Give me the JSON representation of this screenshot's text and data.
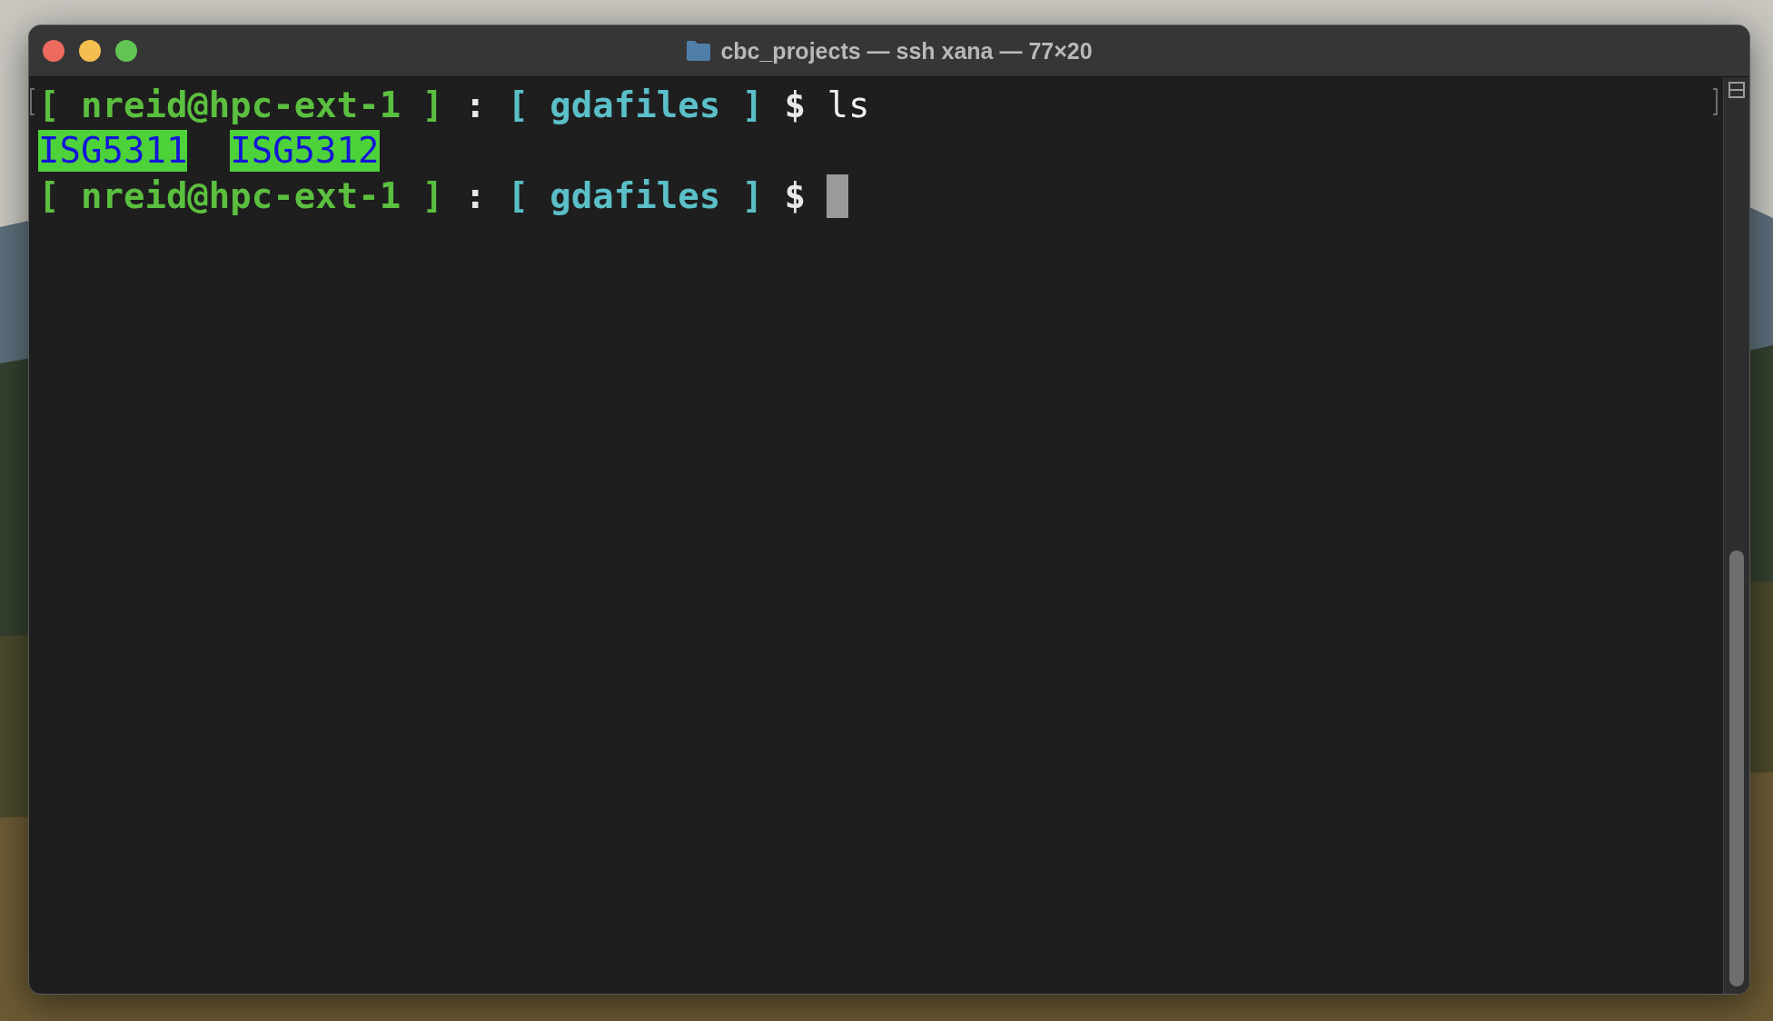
{
  "window": {
    "title": "cbc_projects — ssh xana — 77×20"
  },
  "terminal": {
    "lines": [
      {
        "cursor": false,
        "segments": [
          {
            "kind": "user",
            "text": "[ nreid@hpc-ext-1 ]"
          },
          {
            "kind": "sep",
            "text": ":"
          },
          {
            "kind": "path",
            "text": "[ gdafiles ]"
          },
          {
            "kind": "dollar",
            "text": "$"
          },
          {
            "kind": "command",
            "text": "ls"
          }
        ]
      },
      {
        "cursor": false,
        "segments": [
          {
            "kind": "dir",
            "text": "ISG5311"
          },
          {
            "kind": "dir",
            "text": "ISG5312"
          }
        ]
      },
      {
        "cursor": true,
        "segments": [
          {
            "kind": "user",
            "text": "[ nreid@hpc-ext-1 ]"
          },
          {
            "kind": "sep",
            "text": ":"
          },
          {
            "kind": "path",
            "text": "[ gdafiles ]"
          },
          {
            "kind": "dollar",
            "text": "$"
          }
        ]
      }
    ]
  }
}
